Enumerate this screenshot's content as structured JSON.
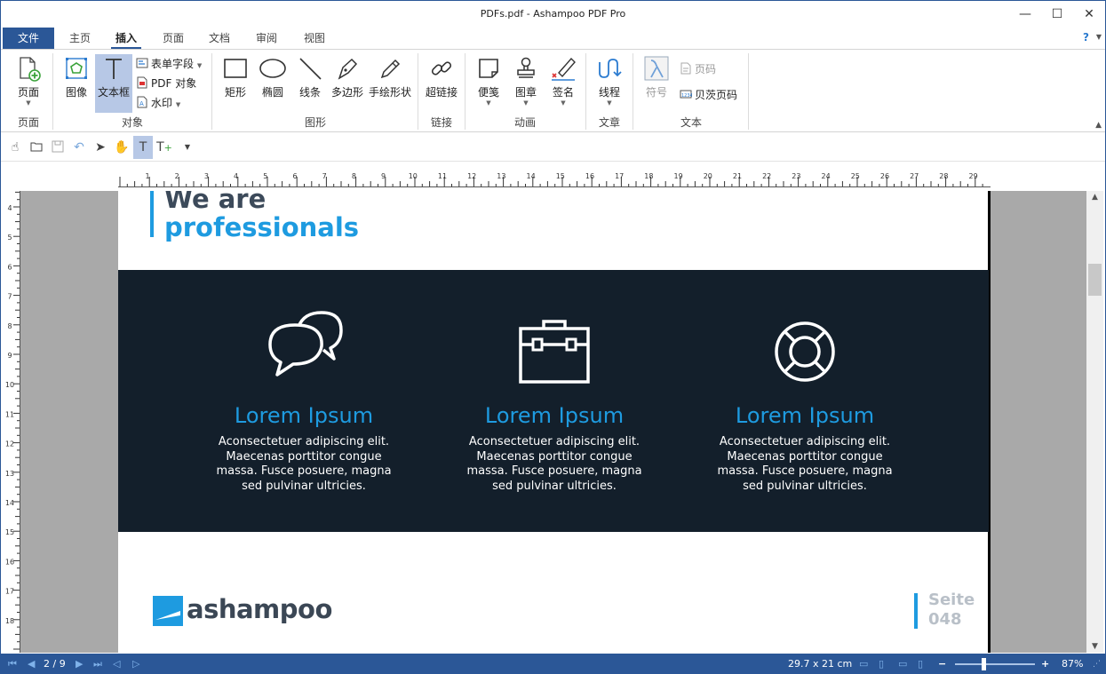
{
  "window": {
    "title": "PDFs.pdf - Ashampoo PDF Pro",
    "minimize_glyph": "—",
    "maximize_glyph": "☐",
    "close_glyph": "✕"
  },
  "ribbon_tabs": {
    "file": "文件",
    "home": "主页",
    "insert": "插入",
    "page": "页面",
    "document": "文档",
    "review": "审阅",
    "view": "视图",
    "help": "?"
  },
  "ribbon": {
    "page_group": {
      "label": "页面",
      "page_btn": "页面"
    },
    "object_group": {
      "label": "对象",
      "image_btn": "图像",
      "textbox_btn": "文本框",
      "form_field": "表单字段",
      "pdf_object": "PDF 对象",
      "watermark": "水印"
    },
    "shape_group": {
      "label": "图形",
      "rect": "矩形",
      "ellipse": "椭圆",
      "line": "线条",
      "polygon": "多边形",
      "freehand": "手绘形状"
    },
    "link_group": {
      "label": "链接",
      "hyperlink": "超链接"
    },
    "anim_group": {
      "label": "动画",
      "note": "便笺",
      "stamp": "图章",
      "signature": "签名"
    },
    "article_group": {
      "label": "文章",
      "thread": "线程"
    },
    "text_group": {
      "label": "文本",
      "symbol": "符号",
      "page_number": "页码",
      "bates": "贝茨页码"
    }
  },
  "document": {
    "hero_line1": "We are",
    "hero_line2": "professionals",
    "features": [
      {
        "icon": "chat-bubbles-icon",
        "title": "Lorem Ipsum",
        "body_lines": [
          "Aconsectetuer adipiscing elit.",
          "Maecenas porttitor congue",
          "massa. Fusce posuere, magna",
          "sed pulvinar ultricies."
        ]
      },
      {
        "icon": "briefcase-icon",
        "title": "Lorem Ipsum",
        "body_lines": [
          "Aconsectetuer adipiscing elit.",
          "Maecenas porttitor congue",
          "massa. Fusce posuere, magna",
          "sed pulvinar ultricies."
        ]
      },
      {
        "icon": "lifebuoy-icon",
        "title": "Lorem Ipsum",
        "body_lines": [
          "Aconsectetuer adipiscing elit.",
          "Maecenas porttitor congue",
          "massa. Fusce posuere, magna",
          "sed pulvinar ultricies."
        ]
      }
    ],
    "logo_text": "ashampoo",
    "seite_label": "Seite",
    "seite_number": "048"
  },
  "rulers": {
    "horizontal_labels": [
      "1",
      "2",
      "3",
      "4",
      "5",
      "6",
      "7",
      "8",
      "9",
      "10",
      "11",
      "12",
      "13",
      "14",
      "15",
      "16",
      "17",
      "18",
      "19",
      "20",
      "21",
      "22",
      "23",
      "24",
      "25",
      "26",
      "27",
      "28",
      "29"
    ],
    "vertical_labels": [
      "4",
      "5",
      "6",
      "7",
      "8",
      "9",
      "10",
      "11",
      "12",
      "13",
      "14",
      "15",
      "16",
      "17",
      "18"
    ]
  },
  "statusbar": {
    "page_indicator": "2 / 9",
    "page_size": "29.7 x 21 cm",
    "zoom": "87%",
    "zoom_fraction": 0.35
  },
  "colors": {
    "accent": "#1e9be0",
    "ribbon_blue": "#2b5797",
    "dark_band": "#131f2b"
  }
}
